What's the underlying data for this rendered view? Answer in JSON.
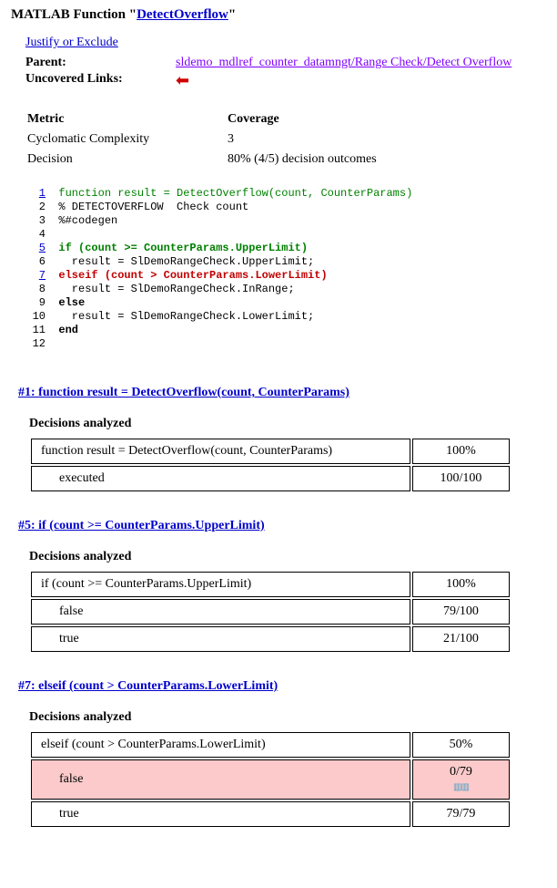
{
  "title_prefix": "MATLAB Function \"",
  "title_link": "DetectOverflow",
  "title_suffix": "\"",
  "justify_link": "Justify or Exclude",
  "parent_label": "Parent:",
  "parent_link": "sldemo_mdlref_counter_datamngt/Range Check/Detect Overflow",
  "uncovered_label": "Uncovered Links:",
  "metrics": {
    "hdr_metric": "Metric",
    "hdr_coverage": "Coverage",
    "row1_label": "Cyclomatic Complexity",
    "row1_value": "3",
    "row2_label": "Decision",
    "row2_value": "80% (4/5) decision outcomes"
  },
  "code": {
    "l1": "function result = DetectOverflow(count, CounterParams)",
    "l2": "% DETECTOVERFLOW  Check count",
    "l3": "%#codegen",
    "l4": "",
    "l5": "if (count >= CounterParams.UpperLimit)",
    "l6": "  result = SlDemoRangeCheck.UpperLimit;",
    "l7": "elseif (count > CounterParams.LowerLimit)",
    "l8": "  result = SlDemoRangeCheck.InRange;",
    "l9": "else",
    "l10": "  result = SlDemoRangeCheck.LowerLimit;",
    "l11": "end",
    "l12": ""
  },
  "sec1": {
    "header": "#1: function result = DetectOverflow(count, CounterParams)",
    "da_title": "Decisions analyzed",
    "row_expr": "function result = DetectOverflow(count, CounterParams)",
    "row_pct": "100%",
    "sub1_label": "executed",
    "sub1_val": "100/100"
  },
  "sec5": {
    "header": "#5: if (count >= CounterParams.UpperLimit)",
    "da_title": "Decisions analyzed",
    "row_expr": "if (count >= CounterParams.UpperLimit)",
    "row_pct": "100%",
    "sub1_label": "false",
    "sub1_val": "79/100",
    "sub2_label": "true",
    "sub2_val": "21/100"
  },
  "sec7": {
    "header": "#7: elseif (count > CounterParams.LowerLimit)",
    "da_title": "Decisions analyzed",
    "row_expr": "elseif (count > CounterParams.LowerLimit)",
    "row_pct": "50%",
    "sub1_label": "false",
    "sub1_val": "0/79",
    "sub2_label": "true",
    "sub2_val": "79/79"
  }
}
